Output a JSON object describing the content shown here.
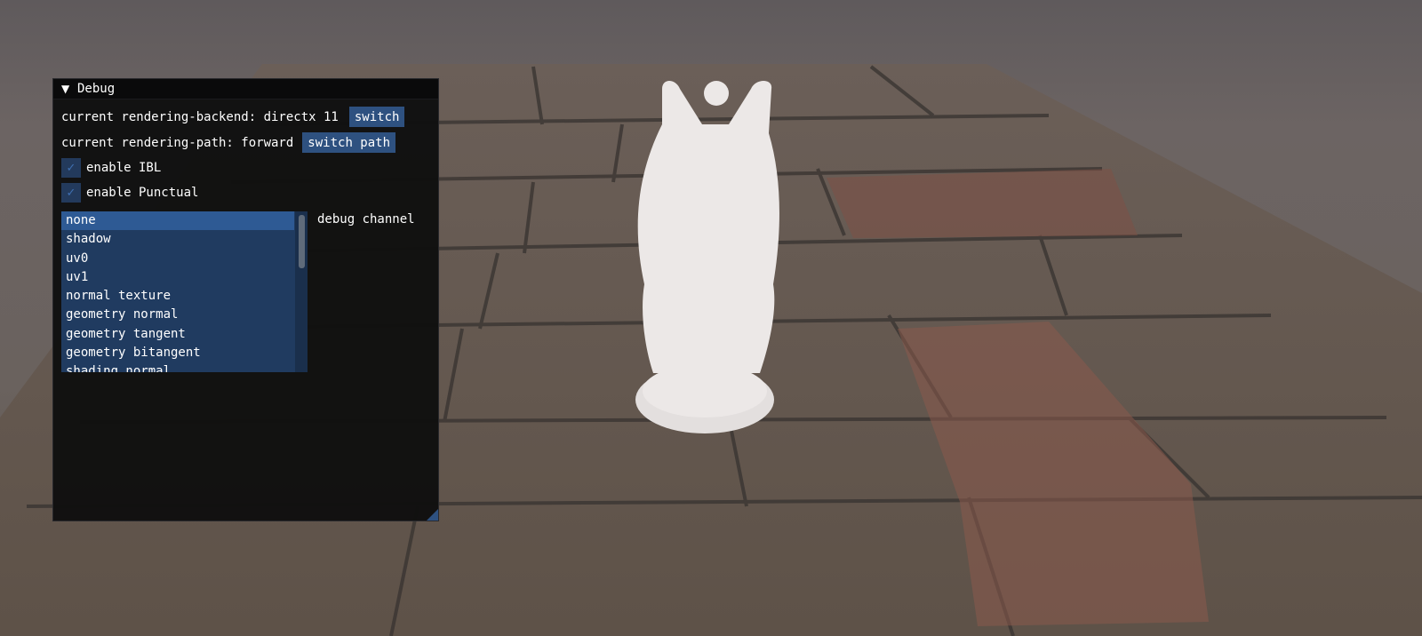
{
  "window": {
    "title": "Debug",
    "collapse_icon": "triangle-down-icon",
    "backend_label": "current rendering-backend: directx 11",
    "switch_label": "switch",
    "path_label": "current rendering-path: forward",
    "switch_path_label": "switch path",
    "enable_ibl_label": "enable IBL",
    "enable_ibl_checked": true,
    "enable_punctual_label": "enable Punctual",
    "enable_punctual_checked": true,
    "channel_label": "debug channel",
    "channel_items": [
      "none",
      "shadow",
      "uv0",
      "uv1",
      "normal texture",
      "geometry normal",
      "geometry tangent",
      "geometry bitangent",
      "shading normal"
    ],
    "channel_selected": "none",
    "check_icon": "checkmark-icon"
  },
  "colors": {
    "accent": "#2e5180",
    "listbox": "#203b60",
    "selected": "#2e5a94",
    "window_bg": "#0f0f10"
  }
}
